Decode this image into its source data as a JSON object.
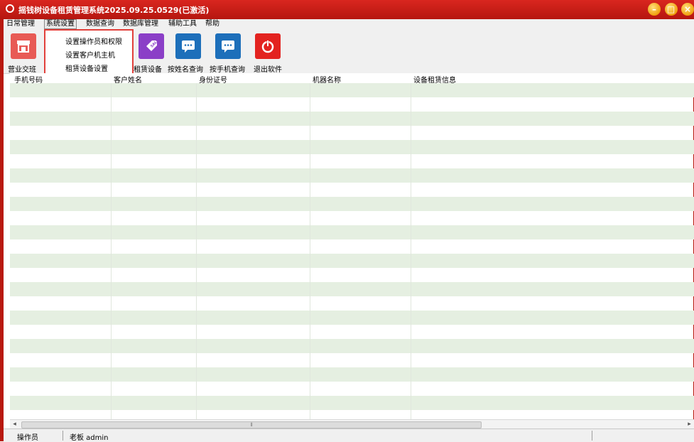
{
  "window": {
    "title": "摇钱树设备租赁管理系统2025.09.25.0529(已激活)",
    "title_bar_color": "#c81e16"
  },
  "menubar": {
    "items": [
      "日常管理",
      "系统设置",
      "数据查询",
      "数据库管理",
      "辅助工具",
      "帮助"
    ],
    "active": "系统设置"
  },
  "dropdown": {
    "items": [
      "设置操作员和权限",
      "设置客户机主机",
      "租赁设备设置"
    ],
    "highlight_color": "#e2403b"
  },
  "toolbar": {
    "buttons": [
      {
        "label": "营业交班",
        "icon": "shop-icon",
        "color": "#e85a55"
      },
      {
        "label": "租赁设备",
        "icon": "sale-tag-icon",
        "color": "#8b3fc7"
      },
      {
        "label": "按姓名查询",
        "icon": "chat-bubble-icon",
        "color": "#1d6fba"
      },
      {
        "label": "按手机查询",
        "icon": "chat-bubble-icon",
        "color": "#1d6fba"
      },
      {
        "label": "退出软件",
        "icon": "power-icon",
        "color": "#e32320"
      }
    ]
  },
  "grid": {
    "columns": [
      "手机号码",
      "客户姓名",
      "身份证号",
      "机器名称",
      "设备租赁信息"
    ],
    "stripe_color": "#e5efe1"
  },
  "statusbar": {
    "operator_label": "操作员",
    "operator_value": "老板 admin"
  }
}
